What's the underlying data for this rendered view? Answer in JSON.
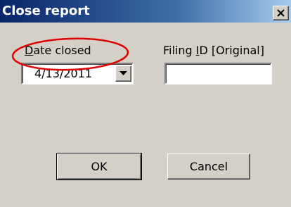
{
  "window": {
    "title": "Close report",
    "close_glyph": "✕"
  },
  "fields": {
    "date_closed": {
      "label_mnemonic": "D",
      "label_rest": "ate closed",
      "value": "4/13/2011"
    },
    "filing_id": {
      "label_before": "Filing ",
      "label_mnemonic": "I",
      "label_after": "D [Original]",
      "value": ""
    }
  },
  "buttons": {
    "ok_label": "OK",
    "cancel_label": "Cancel"
  },
  "annotation": {
    "color": "#e00000"
  },
  "colors": {
    "dialog_bg": "#d4d0c8",
    "titlebar_start": "#0a246a",
    "titlebar_end": "#a6caf0",
    "title_text": "#ffffff"
  }
}
